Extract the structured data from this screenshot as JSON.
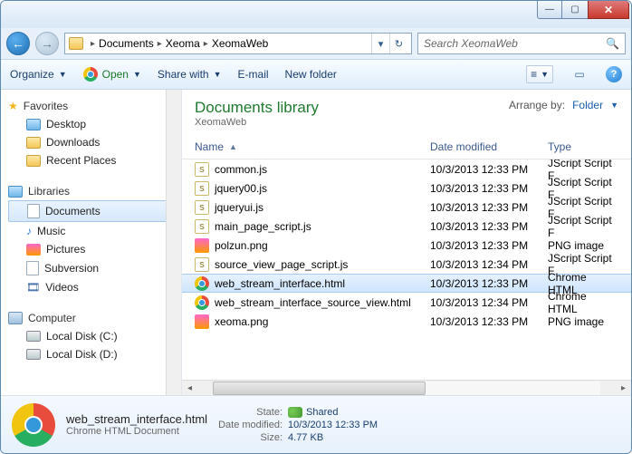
{
  "breadcrumb": {
    "seg1": "Documents",
    "seg2": "Xeoma",
    "seg3": "XeomaWeb"
  },
  "search": {
    "placeholder": "Search XeomaWeb"
  },
  "toolbar": {
    "organize": "Organize",
    "open": "Open",
    "share": "Share with",
    "email": "E-mail",
    "newfolder": "New folder"
  },
  "nav": {
    "favorites": "Favorites",
    "desktop": "Desktop",
    "downloads": "Downloads",
    "recent": "Recent Places",
    "libraries": "Libraries",
    "documents": "Documents",
    "music": "Music",
    "pictures": "Pictures",
    "subversion": "Subversion",
    "videos": "Videos",
    "computer": "Computer",
    "diskc": "Local Disk (C:)",
    "diskd": "Local Disk (D:)"
  },
  "header": {
    "title": "Documents library",
    "subtitle": "XeomaWeb",
    "arrange_lbl": "Arrange by:",
    "arrange_val": "Folder"
  },
  "cols": {
    "name": "Name",
    "date": "Date modified",
    "type": "Type"
  },
  "files": {
    "r0": {
      "n": "common.js",
      "d": "10/3/2013 12:33 PM",
      "t": "JScript Script F"
    },
    "r1": {
      "n": "jquery00.js",
      "d": "10/3/2013 12:33 PM",
      "t": "JScript Script F"
    },
    "r2": {
      "n": "jqueryui.js",
      "d": "10/3/2013 12:33 PM",
      "t": "JScript Script F"
    },
    "r3": {
      "n": "main_page_script.js",
      "d": "10/3/2013 12:33 PM",
      "t": "JScript Script F"
    },
    "r4": {
      "n": "polzun.png",
      "d": "10/3/2013 12:33 PM",
      "t": "PNG image"
    },
    "r5": {
      "n": "source_view_page_script.js",
      "d": "10/3/2013 12:34 PM",
      "t": "JScript Script F"
    },
    "r6": {
      "n": "web_stream_interface.html",
      "d": "10/3/2013 12:33 PM",
      "t": "Chrome HTML"
    },
    "r7": {
      "n": "web_stream_interface_source_view.html",
      "d": "10/3/2013 12:34 PM",
      "t": "Chrome HTML"
    },
    "r8": {
      "n": "xeoma.png",
      "d": "10/3/2013 12:33 PM",
      "t": "PNG image"
    }
  },
  "details": {
    "filename": "web_stream_interface.html",
    "filetype": "Chrome HTML Document",
    "state_k": "State:",
    "state_v": "Shared",
    "mod_k": "Date modified:",
    "mod_v": "10/3/2013 12:33 PM",
    "size_k": "Size:",
    "size_v": "4.77 KB"
  }
}
